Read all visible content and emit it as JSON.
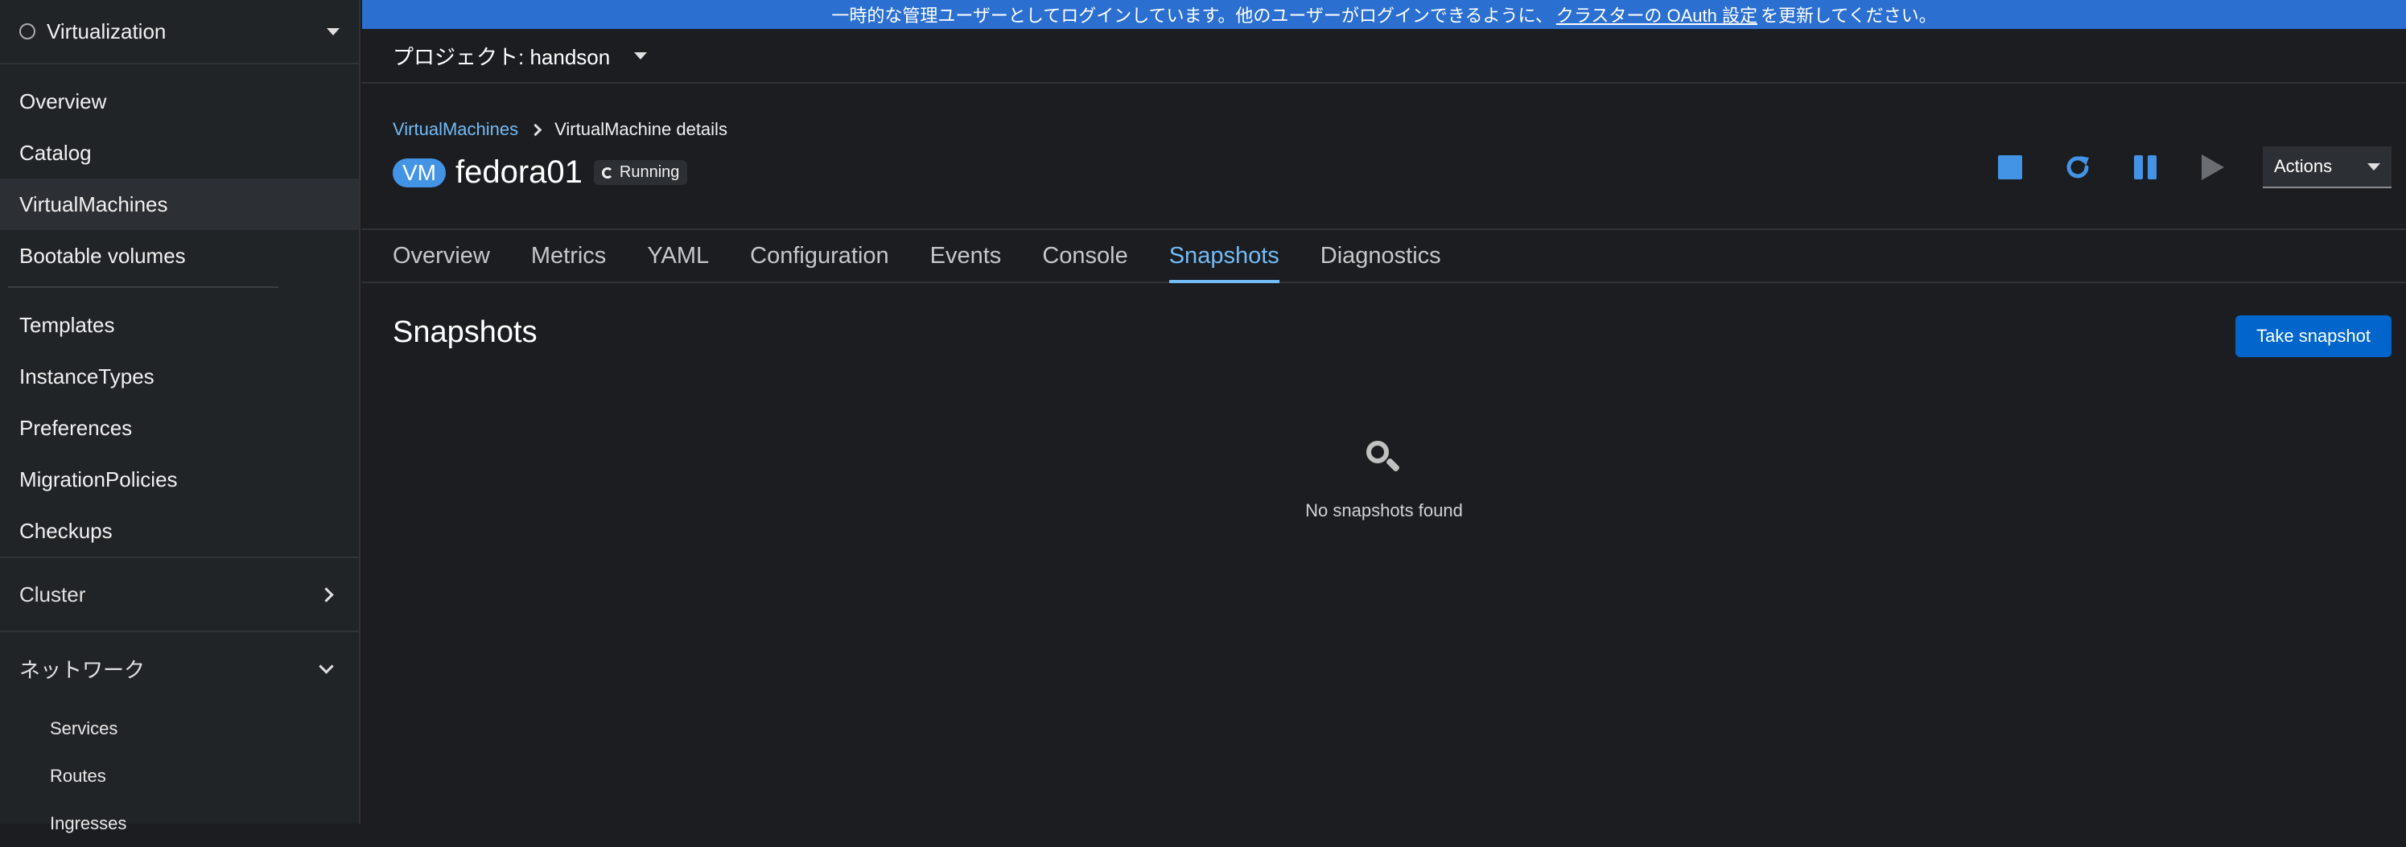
{
  "sidebar": {
    "perspective": "Virtualization",
    "items": [
      {
        "label": "Overview"
      },
      {
        "label": "Catalog"
      },
      {
        "label": "VirtualMachines"
      },
      {
        "label": "Bootable volumes"
      },
      {
        "label": "Templates"
      },
      {
        "label": "InstanceTypes"
      },
      {
        "label": "Preferences"
      },
      {
        "label": "MigrationPolicies"
      },
      {
        "label": "Checkups"
      }
    ],
    "active_item": "VirtualMachines",
    "sections": [
      {
        "label": "Cluster",
        "expanded": false
      },
      {
        "label": "ネットワーク",
        "expanded": true,
        "items": [
          "Services",
          "Routes",
          "Ingresses"
        ]
      }
    ]
  },
  "banner": {
    "text_before": "一時的な管理ユーザーとしてログインしています。他のユーザーがログインできるように、",
    "link": "クラスターの OAuth 設定",
    "text_after": "を更新してください。"
  },
  "project": {
    "label": "プロジェクト: handson"
  },
  "breadcrumb": {
    "parent": "VirtualMachines",
    "current": "VirtualMachine details"
  },
  "vm": {
    "badge": "VM",
    "name": "fedora01",
    "status": "Running"
  },
  "actions": {
    "label": "Actions"
  },
  "tabs": [
    "Overview",
    "Metrics",
    "YAML",
    "Configuration",
    "Events",
    "Console",
    "Snapshots",
    "Diagnostics"
  ],
  "active_tab": "Snapshots",
  "content": {
    "title": "Snapshots",
    "button": "Take snapshot",
    "empty_text": "No snapshots found"
  },
  "colors": {
    "accent": "#73bcf7",
    "banner": "#2b6fd1",
    "primary_button": "#0066cc"
  }
}
